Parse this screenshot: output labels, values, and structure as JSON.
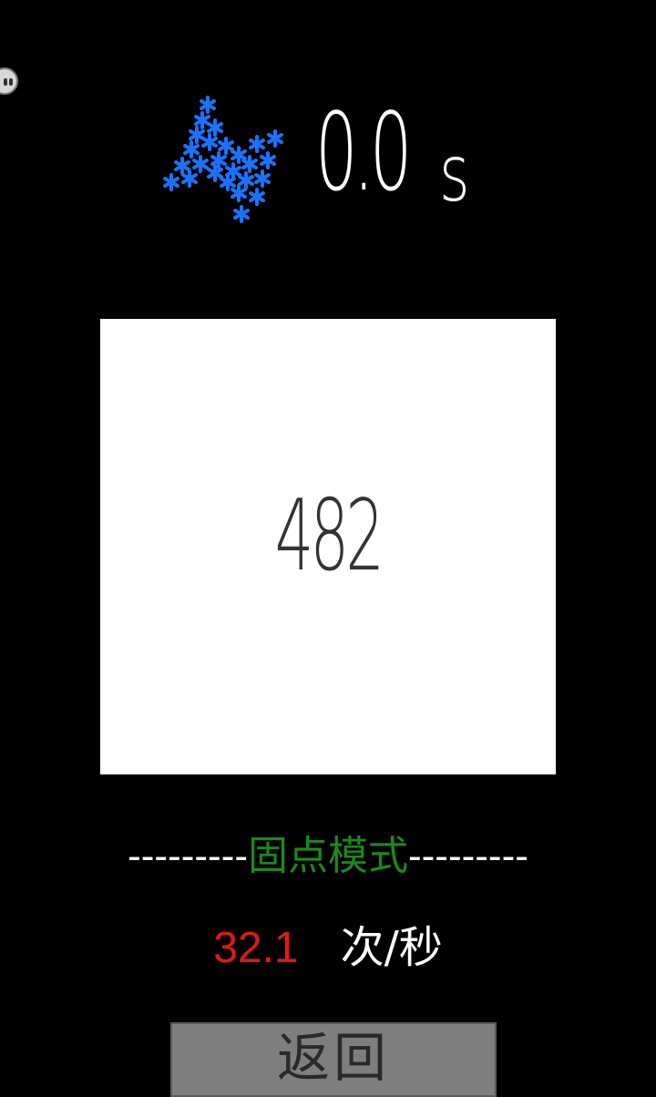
{
  "app": {
    "accent_color": "#1a73ff"
  },
  "header": {
    "icon": "lightning-icon",
    "timer_value": "0.0",
    "timer_unit": "s"
  },
  "tap_area": {
    "count": "482",
    "background": "#ffffff"
  },
  "mode": {
    "dashes_left": "---------",
    "label": "固点模式",
    "dashes_right": "---------",
    "label_color": "#1a8a1a"
  },
  "speed": {
    "value": "32.1",
    "unit": "次/秒",
    "value_color": "#e01818"
  },
  "footer": {
    "back_label": "返回"
  },
  "floating_assist": {
    "icon": "assistive-ball-icon"
  }
}
